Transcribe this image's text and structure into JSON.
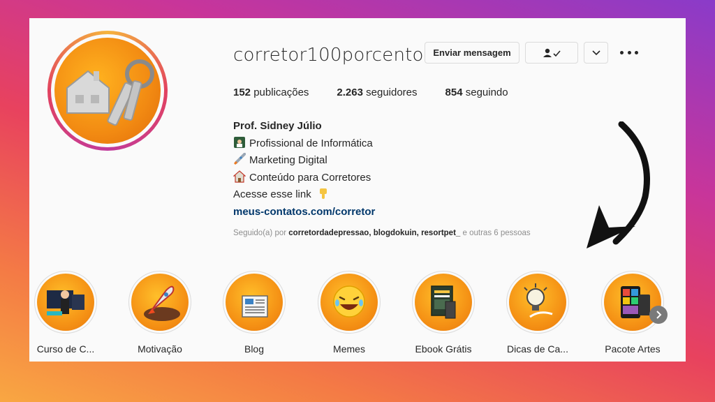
{
  "profile": {
    "username": "corretor100porcento",
    "buttons": {
      "message": "Enviar mensagem"
    },
    "stats": [
      {
        "value": "152",
        "label": "publicações"
      },
      {
        "value": "2.263",
        "label": "seguidores"
      },
      {
        "value": "854",
        "label": "seguindo"
      }
    ],
    "bio": {
      "name": "Prof. Sidney Júlio",
      "lines": [
        "Profissional de Informática",
        "Marketing Digital",
        "Conteúdo para Corretores",
        "Acesse esse link"
      ],
      "link": "meus-contatos.com/corretor"
    },
    "followed_by": {
      "prefix": "Seguido(a) por",
      "names": "corretordadepressao, blogdokuin, resortpet_",
      "suffix": "e outras 6 pessoas"
    }
  },
  "highlights": [
    {
      "label": "Curso de C..."
    },
    {
      "label": "Motivação"
    },
    {
      "label": "Blog"
    },
    {
      "label": "Memes"
    },
    {
      "label": "Ebook Grátis"
    },
    {
      "label": "Dicas de Ca..."
    },
    {
      "label": "Pacote Artes"
    }
  ],
  "icons": [
    "person-check-icon",
    "chevron-down-icon",
    "more-options-icon",
    "chevron-right-icon",
    "arrow-icon"
  ],
  "colors": {
    "link": "#00376b",
    "text": "#262626",
    "muted": "#8e8e8e",
    "border": "#dbdbdb"
  }
}
